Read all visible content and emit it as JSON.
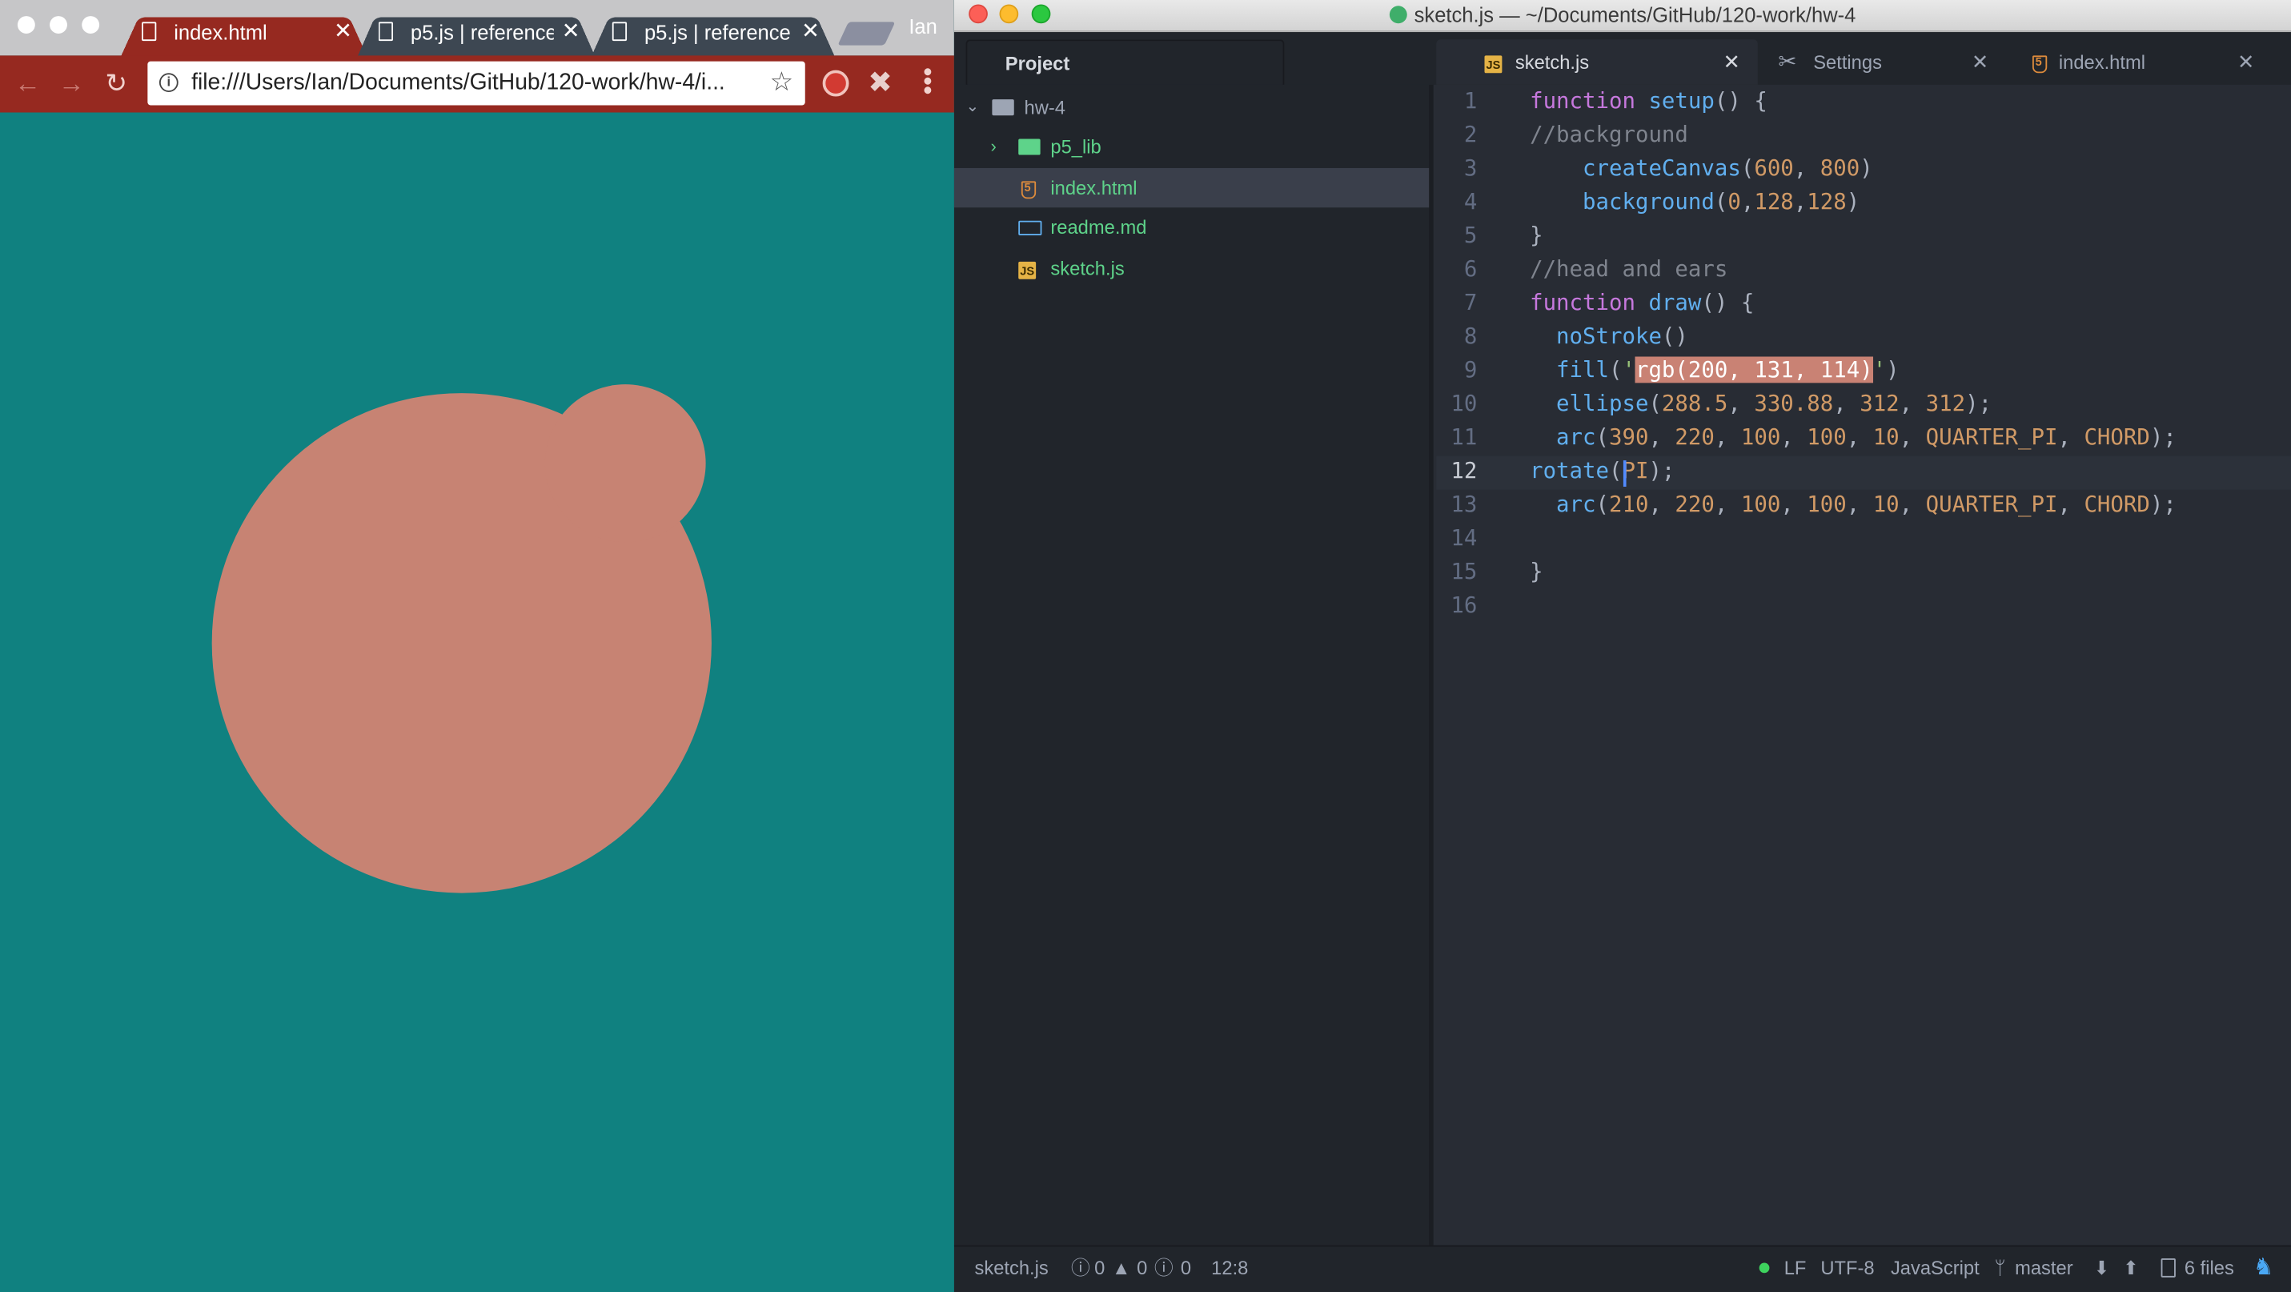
{
  "chrome": {
    "tabs": [
      {
        "title": "index.html"
      },
      {
        "title": "p5.js | reference"
      },
      {
        "title": "p5.js | reference"
      }
    ],
    "profile": "Ian",
    "url": "file:///Users/Ian/Documents/GitHub/120-work/hw-4/i...",
    "canvas_bg": "#108180",
    "face_color": "#c78373"
  },
  "atom": {
    "window_title": "sketch.js — ~/Documents/GitHub/120-work/hw-4",
    "tree_title": "Project",
    "tabs": [
      {
        "title": "sketch.js",
        "icon": "js-icon"
      },
      {
        "title": "Settings",
        "icon": "tools-icon"
      },
      {
        "title": "index.html",
        "icon": "html5-icon"
      }
    ],
    "tree": [
      {
        "label": "hw-4",
        "icon": "folder-icon"
      },
      {
        "label": "p5_lib",
        "icon": "folder-icon"
      },
      {
        "label": "index.html",
        "icon": "html5-icon"
      },
      {
        "label": "readme.md",
        "icon": "book-icon"
      },
      {
        "label": "sketch.js",
        "icon": "js-icon"
      }
    ],
    "line_numbers": [
      "1",
      "2",
      "3",
      "4",
      "5",
      "6",
      "7",
      "8",
      "9",
      "10",
      "11",
      "12",
      "13",
      "14",
      "15",
      "16"
    ],
    "current_line": "12",
    "status": {
      "file": "sketch.js",
      "errors": "0",
      "warnings": "0",
      "infos": "0",
      "cursor": "12:8",
      "line_ending": "LF",
      "encoding": "UTF-8",
      "grammar": "JavaScript",
      "branch": "master",
      "files": "6 files"
    }
  }
}
